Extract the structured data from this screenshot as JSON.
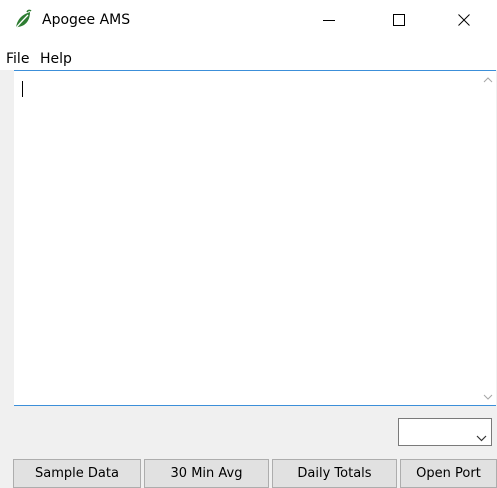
{
  "window": {
    "title": "Apogee AMS",
    "icon": "leaf-icon",
    "controls": {
      "minimize_icon": "minimize-icon",
      "maximize_icon": "maximize-icon",
      "close_icon": "close-icon"
    }
  },
  "menubar": {
    "items": [
      {
        "label": "File"
      },
      {
        "label": "Help"
      }
    ]
  },
  "output": {
    "text": "",
    "accent_color": "#3c8fd9"
  },
  "combo": {
    "selected": ""
  },
  "buttons": {
    "sample_data": "Sample Data",
    "min_avg": "30 Min Avg",
    "daily_totals": "Daily Totals",
    "open_port": "Open Port"
  }
}
